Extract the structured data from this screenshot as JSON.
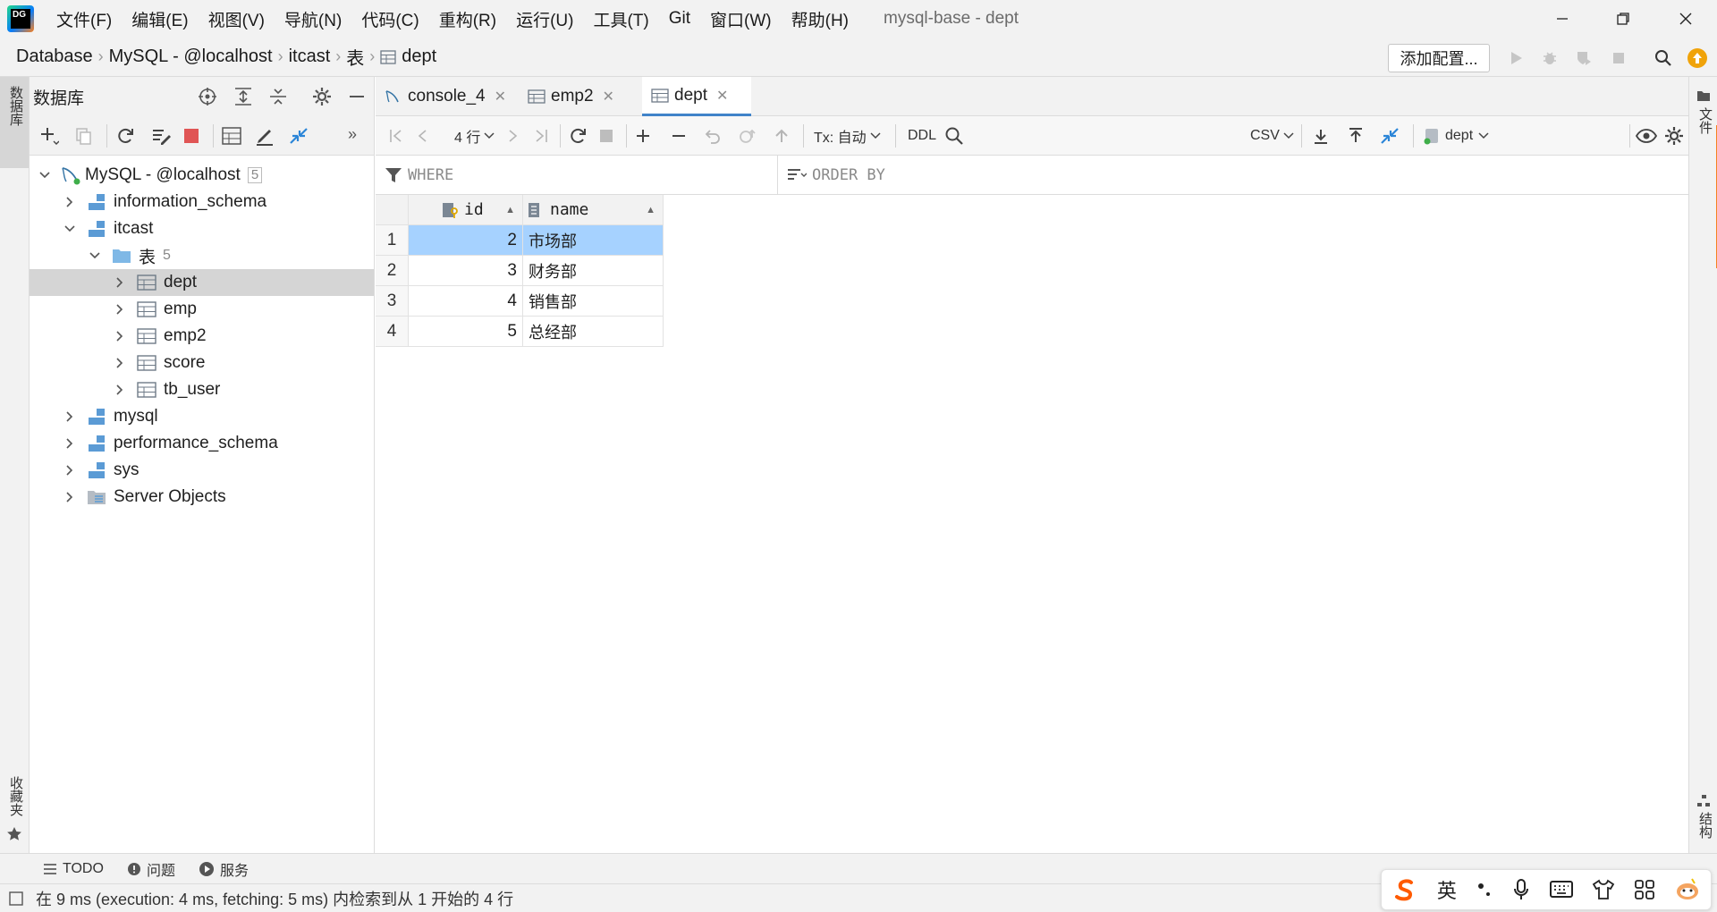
{
  "app": {
    "window_title": "mysql-base - dept"
  },
  "menu": [
    "文件(F)",
    "编辑(E)",
    "视图(V)",
    "导航(N)",
    "代码(C)",
    "重构(R)",
    "运行(U)",
    "工具(T)",
    "Git",
    "窗口(W)",
    "帮助(H)"
  ],
  "breadcrumb": [
    "Database",
    "MySQL - @localhost",
    "itcast",
    "表",
    "dept"
  ],
  "toolbar": {
    "add_config_label": "添加配置..."
  },
  "db_panel": {
    "title": "数据库",
    "left_strip_label": "数据库",
    "favorites_label": "收藏夹",
    "tree": [
      {
        "label": "MySQL - @localhost",
        "count": "5"
      },
      {
        "label": "information_schema"
      },
      {
        "label": "itcast"
      },
      {
        "label": "表",
        "count": "5"
      },
      {
        "label": "dept"
      },
      {
        "label": "emp"
      },
      {
        "label": "emp2"
      },
      {
        "label": "score"
      },
      {
        "label": "tb_user"
      },
      {
        "label": "mysql"
      },
      {
        "label": "performance_schema"
      },
      {
        "label": "sys"
      },
      {
        "label": "Server Objects"
      }
    ]
  },
  "editor": {
    "tabs": [
      {
        "label": "console_4"
      },
      {
        "label": "emp2"
      },
      {
        "label": "dept"
      }
    ],
    "grid_toolbar": {
      "rows_label": "4 行",
      "tx_label": "Tx: 自动",
      "ddl_label": "DDL",
      "export_format": "CSV",
      "schema_label": "dept"
    },
    "filter": {
      "where_label": "WHERE",
      "order_by_label": "ORDER BY"
    },
    "table": {
      "columns": [
        "id",
        "name"
      ],
      "rows": [
        {
          "num": "1",
          "id": "2",
          "name": "市场部"
        },
        {
          "num": "2",
          "id": "3",
          "name": "财务部"
        },
        {
          "num": "3",
          "id": "4",
          "name": "销售部"
        },
        {
          "num": "4",
          "id": "5",
          "name": "总经部"
        }
      ]
    }
  },
  "right_strip": {
    "top_label": "文件",
    "bottom_label": "结构"
  },
  "bottom_tabs": [
    "TODO",
    "问题",
    "服务"
  ],
  "status": {
    "message": "在 9 ms (execution: 4 ms, fetching: 5 ms) 内检索到从 1 开始的 4 行"
  },
  "ime": {
    "lang_label": "英"
  },
  "colors": {
    "accent": "#4083c9",
    "selection": "#a6d2ff",
    "stop_red": "#e05555",
    "warning_orange": "#f0a30a"
  }
}
